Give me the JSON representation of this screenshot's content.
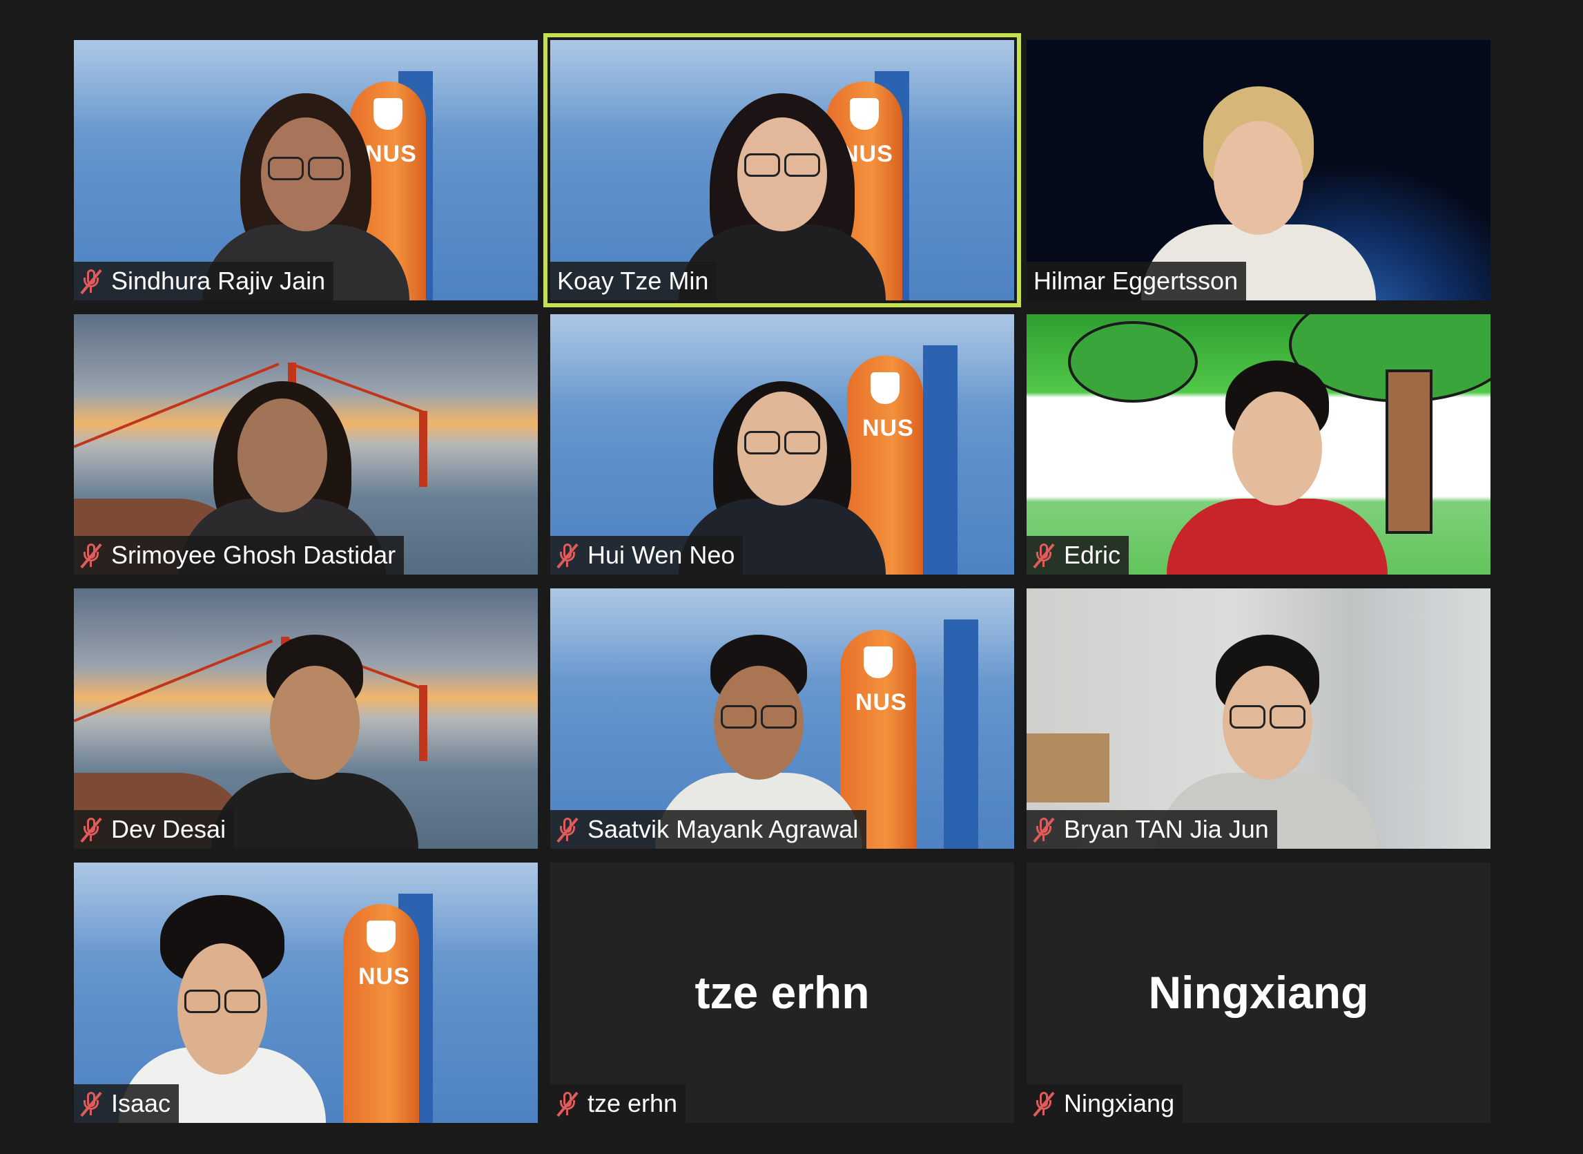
{
  "participants": [
    {
      "name": "Sindhura Rajiv Jain",
      "muted": true,
      "active_speaker": false,
      "video": "nus-background"
    },
    {
      "name": "Koay Tze Min",
      "muted": false,
      "active_speaker": true,
      "video": "nus-background"
    },
    {
      "name": "Hilmar Eggertsson",
      "muted": false,
      "active_speaker": false,
      "video": "space-background"
    },
    {
      "name": "Srimoyee Ghosh Dastidar",
      "muted": true,
      "active_speaker": false,
      "video": "bridge-background"
    },
    {
      "name": "Hui Wen Neo",
      "muted": true,
      "active_speaker": false,
      "video": "nus-background"
    },
    {
      "name": "Edric",
      "muted": true,
      "active_speaker": false,
      "video": "cartoon-background"
    },
    {
      "name": "Dev Desai",
      "muted": true,
      "active_speaker": false,
      "video": "bridge-background"
    },
    {
      "name": "Saatvik Mayank Agrawal",
      "muted": true,
      "active_speaker": false,
      "video": "nus-background"
    },
    {
      "name": "Bryan TAN Jia Jun",
      "muted": true,
      "active_speaker": false,
      "video": "room-background"
    },
    {
      "name": "Isaac",
      "muted": true,
      "active_speaker": false,
      "video": "nus-background"
    },
    {
      "name": "tze erhn",
      "muted": true,
      "active_speaker": false,
      "video": "off",
      "display_name": "tze erhn"
    },
    {
      "name": "Ningxiang",
      "muted": true,
      "active_speaker": false,
      "video": "off",
      "display_name": "Ningxiang"
    }
  ],
  "nus_sign": {
    "text": "NUS"
  },
  "colors": {
    "background": "#1a1a1a",
    "tile_off": "#232323",
    "active_speaker_border": "#c6e04f",
    "muted_icon": "#e25b5b",
    "nus_orange": "#f08a36",
    "nus_blue": "#2c63b0"
  }
}
